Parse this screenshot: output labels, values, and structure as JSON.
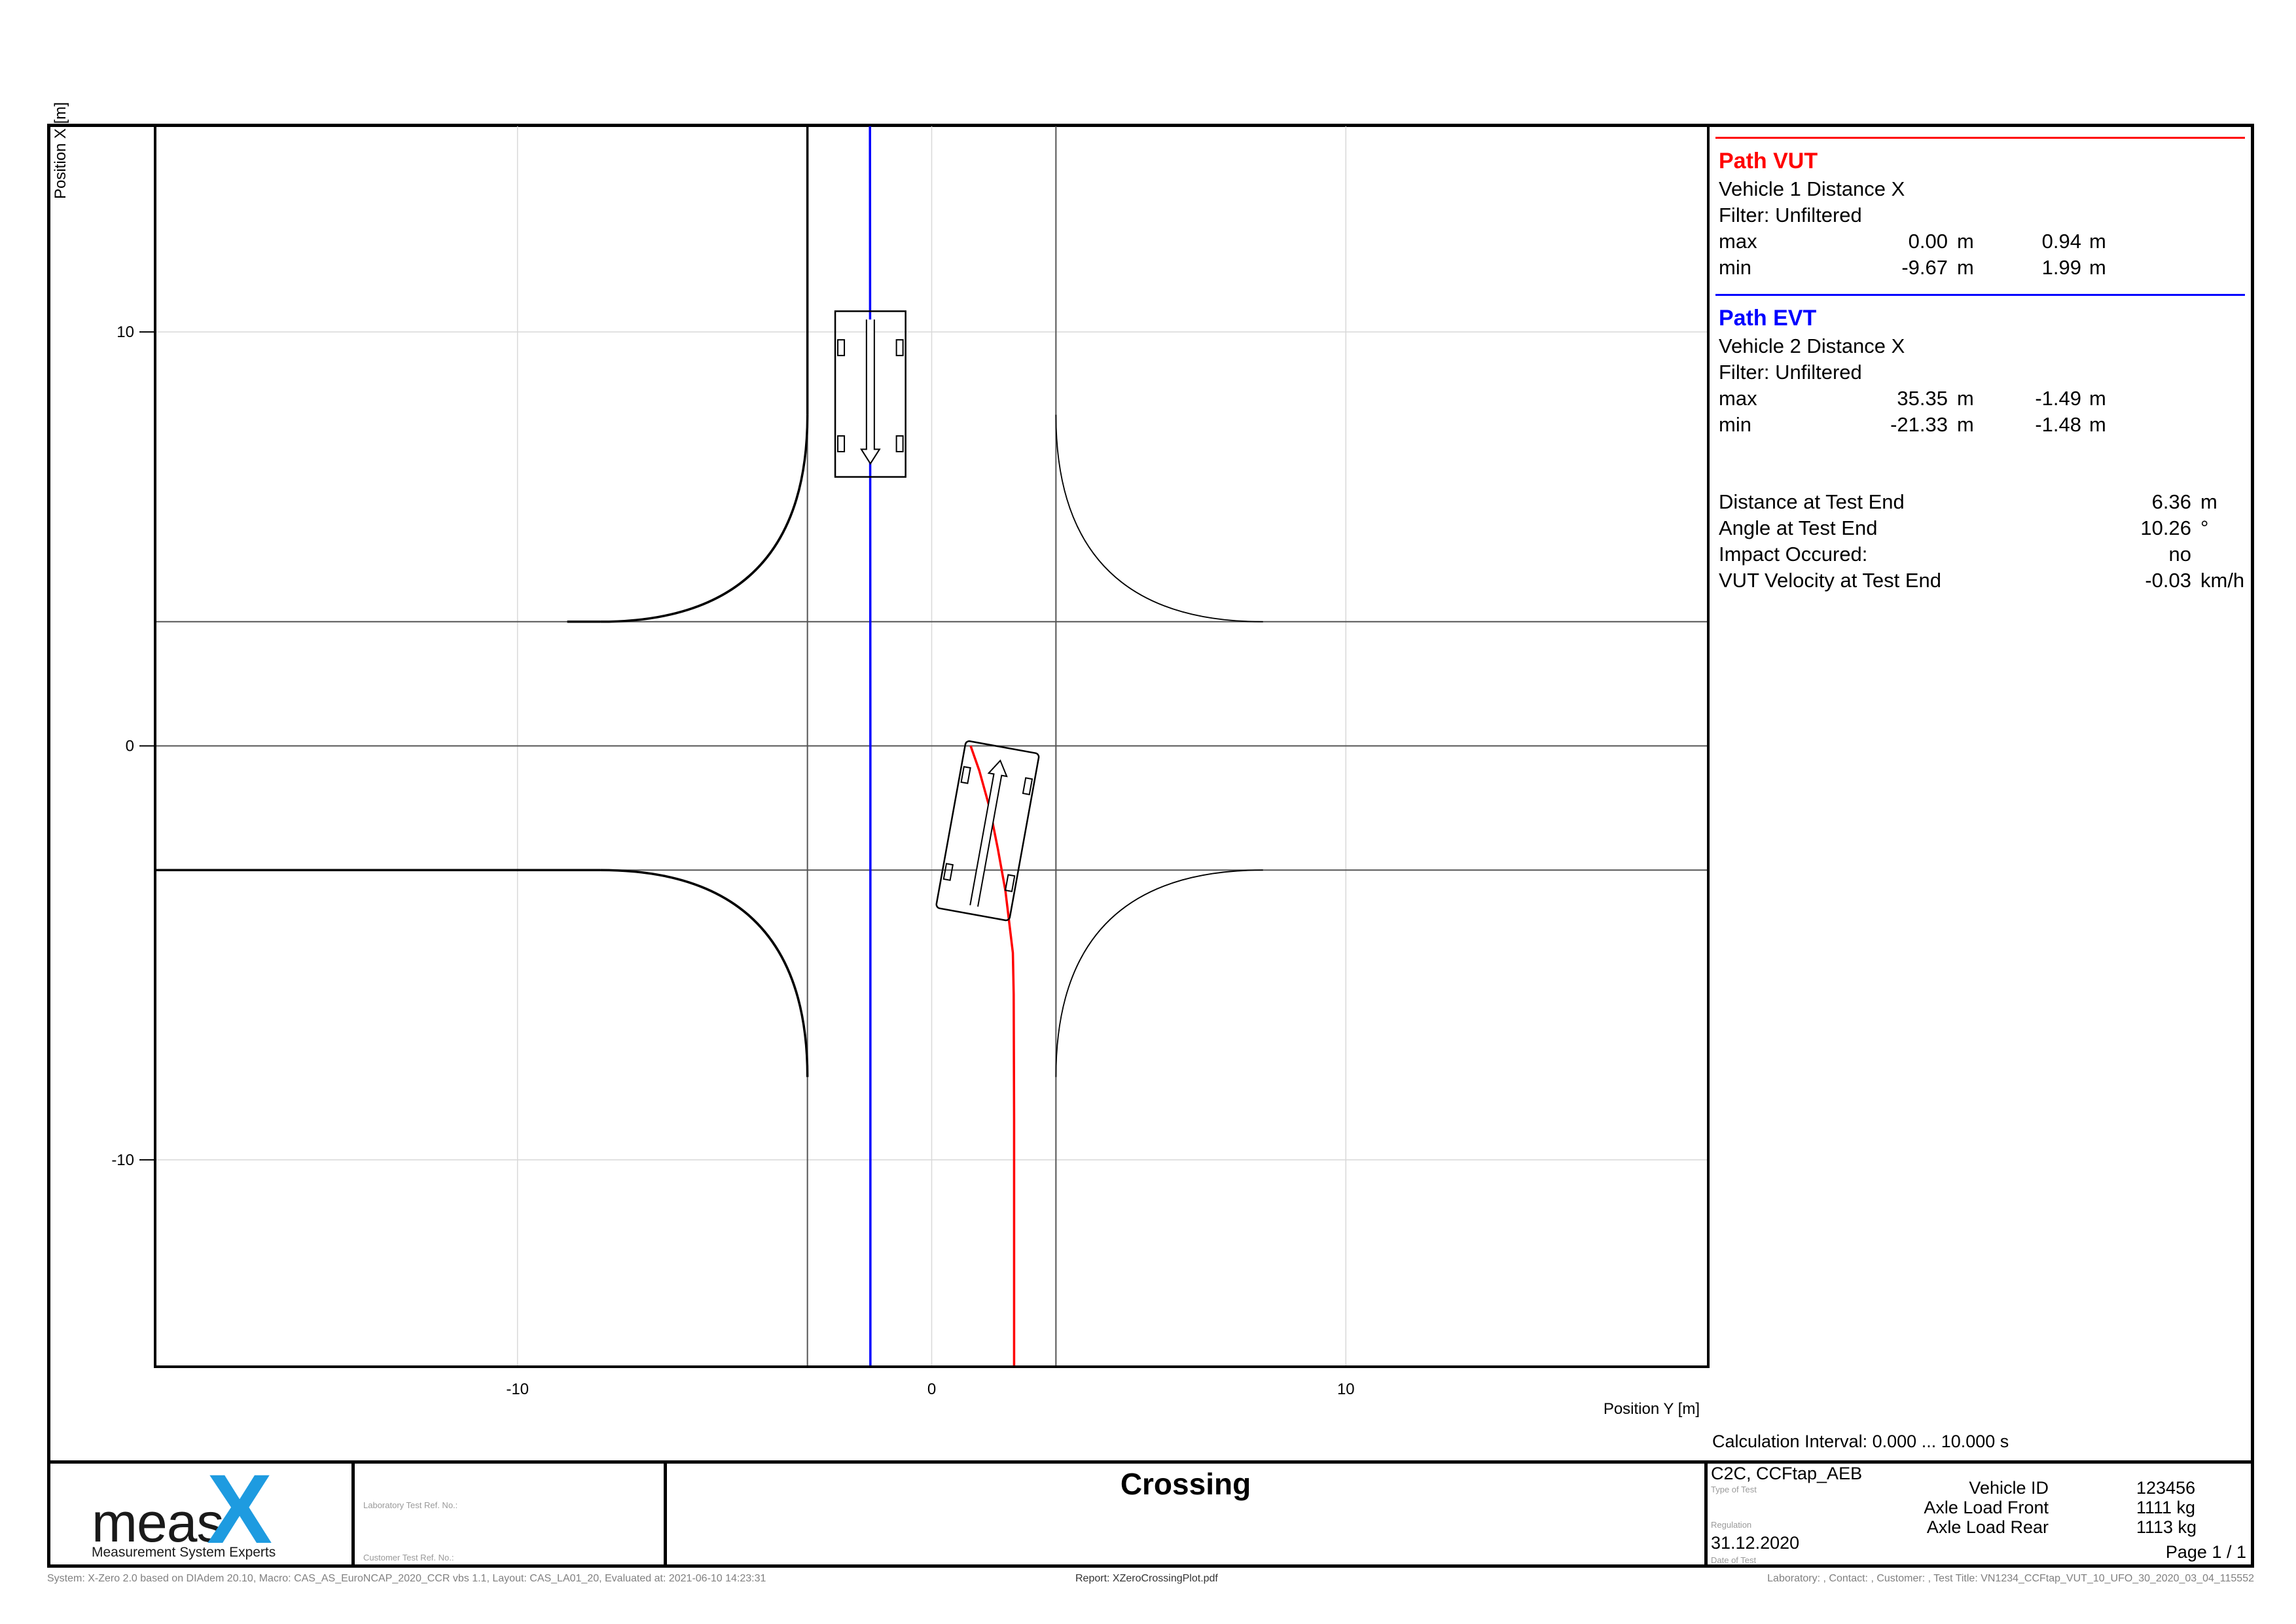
{
  "chart_data": {
    "type": "line",
    "title": "Crossing",
    "xlabel": "Position Y [m]",
    "ylabel": "Position X [m]",
    "xlim": [
      -18.75,
      18.75
    ],
    "ylim": [
      -15,
      15
    ],
    "xticks": [
      -10,
      0,
      10
    ],
    "yticks": [
      10,
      0,
      -10
    ],
    "grid": true,
    "series": [
      {
        "name": "Path VUT",
        "color": "#ff0000",
        "points": [
          [
            1.99,
            -15
          ],
          [
            1.99,
            -9.0
          ],
          [
            1.98,
            -6.0
          ],
          [
            1.96,
            -5.0
          ],
          [
            1.9,
            -4.5
          ],
          [
            1.78,
            -3.5
          ],
          [
            1.6,
            -2.5
          ],
          [
            1.4,
            -1.5
          ],
          [
            1.15,
            -0.6
          ],
          [
            0.94,
            0.0
          ]
        ]
      },
      {
        "name": "Path EVT",
        "color": "#0000ff",
        "points": [
          [
            -1.48,
            -15
          ],
          [
            -1.48,
            0
          ],
          [
            -1.49,
            15
          ]
        ]
      }
    ],
    "road_edges": {
      "horizontal_lines_y": [
        3,
        -3
      ],
      "vertical_lines_x": [
        -3,
        3
      ],
      "center_line_y": 0
    },
    "vehicles": [
      {
        "name": "EVT",
        "center": [
          -1.48,
          8.5
        ],
        "length": 4.0,
        "width": 1.7,
        "heading_deg": 180
      },
      {
        "name": "VUT",
        "center": [
          1.35,
          -2.05
        ],
        "length": 4.1,
        "width": 1.8,
        "heading_deg": 10.26
      }
    ]
  },
  "panel": {
    "vut": {
      "title": "Path VUT",
      "title_color": "#ff0000",
      "subtitle": "Vehicle 1 Distance X",
      "filter": "Filter:  Unfiltered",
      "max_label": "max",
      "max_v1": "0.00",
      "max_u1": "m",
      "max_v2": "0.94",
      "max_u2": "m",
      "min_label": "min",
      "min_v1": "-9.67",
      "min_u1": "m",
      "min_v2": "1.99",
      "min_u2": "m"
    },
    "evt": {
      "title": "Path EVT",
      "title_color": "#0000ff",
      "subtitle": "Vehicle 2 Distance X",
      "filter": "Filter:  Unfiltered",
      "max_label": "max",
      "max_v1": "35.35",
      "max_u1": "m",
      "max_v2": "-1.49",
      "max_u2": "m",
      "min_label": "min",
      "min_v1": "-21.33",
      "min_u1": "m",
      "min_v2": "-1.48",
      "min_u2": "m"
    },
    "results": {
      "distance_label": "Distance at Test End",
      "distance_value": "6.36",
      "distance_unit": "m",
      "angle_label": "Angle at Test End",
      "angle_value": "10.26",
      "angle_unit": "°",
      "impact_label": "Impact Occured:",
      "impact_value": "no",
      "velocity_label": "VUT Velocity at Test End",
      "velocity_value": "-0.03",
      "velocity_unit": "km/h"
    },
    "calc_interval": "Calculation Interval: 0.000 ... 10.000 s"
  },
  "footer": {
    "logo_text": "meas",
    "logo_x": "X",
    "logo_tagline": "Measurement System Experts",
    "lab_ref_label": "Laboratory Test Ref. No.:",
    "cust_ref_label": "Customer Test Ref. No.:",
    "title": "Crossing",
    "type_of_test": "C2C, CCFtap_AEB",
    "type_of_test_label": "Type of Test",
    "regulation_label": "Regulation",
    "date": "31.12.2020",
    "date_label": "Date of Test",
    "vehicle_id_label": "Vehicle ID",
    "vehicle_id": "123456",
    "axle_front_label": "Axle Load Front",
    "axle_front": "1111 kg",
    "axle_rear_label": "Axle Load Rear",
    "axle_rear": "1113 kg",
    "page": "Page 1 / 1"
  },
  "meta": {
    "system": "System: X-Zero 2.0 based on DIAdem 20.10, Macro: CAS_AS_EuroNCAP_2020_CCR vbs 1.1, Layout: CAS_LA01_20, Evaluated at: 2021-06-10 14:23:31",
    "report": "Report: XZeroCrossingPlot.pdf",
    "info": "Laboratory: , Contact: , Customer: , Test Title: VN1234_CCFtap_VUT_10_UFO_30_2020_03_04_115552"
  },
  "colors": {
    "vut": "#ff0000",
    "evt": "#0000ff",
    "logo_blue": "#1e9be0"
  }
}
